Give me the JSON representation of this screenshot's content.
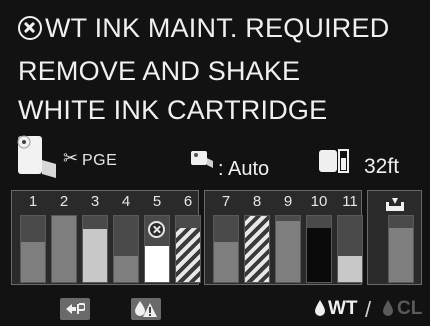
{
  "message": {
    "line1": "WT INK MAINT. REQUIRED",
    "line2": "REMOVE AND SHAKE",
    "line3": "WHITE INK CARTRIDGE",
    "icon": "error-x-circle-icon"
  },
  "status": {
    "paper_icon": "roll-paper-icon",
    "cutter_icon": "scissors-icon",
    "page_label": "PGE",
    "feed_icon": "roll-feed-icon",
    "feed_mode": "Auto",
    "remaining_icon": "roll-remaining-icon",
    "remaining_length": "32ft"
  },
  "ink": {
    "groups": [
      {
        "slots": [
          {
            "number": "1",
            "level": 0.6,
            "style": "gray"
          },
          {
            "number": "2",
            "level": 1.0,
            "style": "gray"
          },
          {
            "number": "3",
            "level": 0.8,
            "style": "light"
          },
          {
            "number": "4",
            "level": 0.4,
            "style": "gray"
          },
          {
            "number": "5",
            "level": 0.55,
            "style": "white",
            "error": true
          },
          {
            "number": "6",
            "level": 0.82,
            "style": "hatched"
          }
        ]
      },
      {
        "slots": [
          {
            "number": "7",
            "level": 0.6,
            "style": "gray"
          },
          {
            "number": "8",
            "level": 1.0,
            "style": "hatched"
          },
          {
            "number": "9",
            "level": 0.92,
            "style": "gray"
          },
          {
            "number": "10",
            "level": 0.82,
            "style": "black"
          },
          {
            "number": "11",
            "level": 0.4,
            "style": "light"
          }
        ]
      },
      {
        "slots": [
          {
            "number": "",
            "level": 0.82,
            "style": "gray",
            "icon": "maintenance-box-icon"
          }
        ]
      }
    ]
  },
  "bottom": {
    "printer_button_icon": "printer-status-icon",
    "warning_button_icon": "ink-warning-icon",
    "white_ink_label": "WT",
    "separator": "/",
    "clean_label": "CL"
  },
  "colors": {
    "background": "#121212",
    "panel": "#2a2a2a",
    "text": "#f0f0f0",
    "disabled": "#5a5a5a"
  }
}
